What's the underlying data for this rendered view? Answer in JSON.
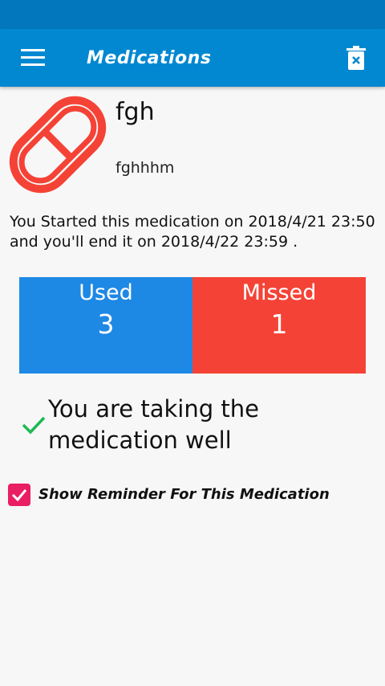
{
  "app_bar": {
    "title": "Medications",
    "menu_icon": "hamburger-menu-icon",
    "delete_icon": "trash-delete-icon"
  },
  "medication": {
    "name": "fgh",
    "description": "fghhhm",
    "icon": "pill-icon",
    "icon_color": "#f44336",
    "schedule_text": "You Started this medication on 2018/4/21 23:50 and you'll end it on 2018/4/22 23:59 ."
  },
  "stats": {
    "used_label": "Used",
    "used_value": "3",
    "used_color": "#1e88e5",
    "missed_label": "Missed",
    "missed_value": "1",
    "missed_color": "#f44336"
  },
  "status": {
    "message": "You are taking the medication well",
    "icon": "check-icon",
    "icon_color": "#1db954"
  },
  "reminder": {
    "label": "Show Reminder For This Medication",
    "checked": true,
    "color": "#e91e63"
  },
  "colors": {
    "status_bar": "#0277bd",
    "app_bar": "#0288d1",
    "background": "#f7f7f7"
  }
}
